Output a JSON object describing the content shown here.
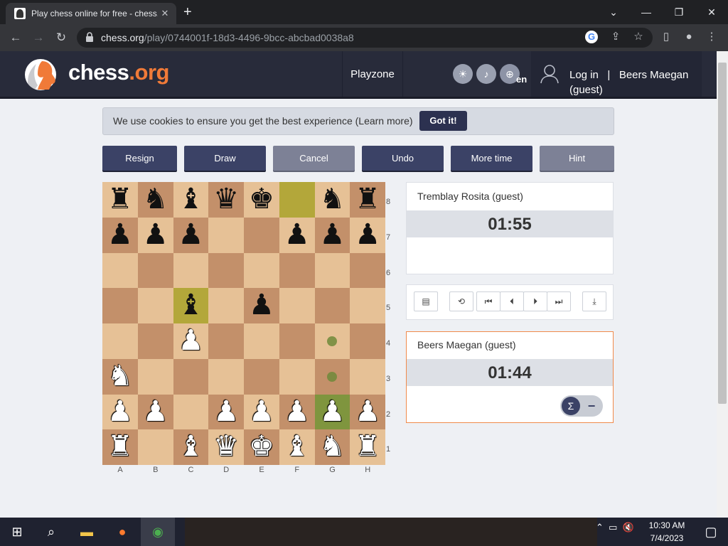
{
  "browser": {
    "tab_title": "Play chess online for free - chess.org",
    "tab_close": "✕",
    "new_tab": "+",
    "url_host": "chess.org",
    "url_path": "/play/0744001f-18d3-4496-9bcc-abcbad0038a8"
  },
  "header": {
    "logo_main": "chess",
    "logo_tld": ".org",
    "nav_playzone": "Playzone",
    "lang": "en",
    "login": "Log in",
    "separator": "|",
    "username": "Beers Maegan",
    "user_status": "(guest)"
  },
  "cookie": {
    "text": "We use cookies to ensure you get the best experience (Learn more)",
    "button": "Got it!"
  },
  "actions": {
    "resign": "Resign",
    "draw": "Draw",
    "cancel": "Cancel",
    "undo": "Undo",
    "more_time": "More time",
    "hint": "Hint"
  },
  "board": {
    "files": [
      "A",
      "B",
      "C",
      "D",
      "E",
      "F",
      "G",
      "H"
    ],
    "ranks": [
      "8",
      "7",
      "6",
      "5",
      "4",
      "3",
      "2",
      "1"
    ],
    "pieces": [
      "rnbqk.nr",
      "ppp..ppp",
      "........",
      "..b.p...",
      "..P.....",
      "N.......",
      "PP.PPPPP",
      "R.BQKBNR"
    ],
    "highlights": [
      "f8",
      "c5"
    ],
    "selected": [
      "g2"
    ],
    "move_hints": [
      "g4",
      "g3"
    ]
  },
  "players": {
    "top": {
      "name": "Tremblay Rosita (guest)",
      "clock": "01:55"
    },
    "bottom": {
      "name": "Beers Maegan (guest)",
      "clock": "01:44"
    }
  },
  "controls": {
    "sigma": "Σ",
    "minus": "−"
  },
  "taskbar": {
    "time": "10:30 AM",
    "date": "7/4/2023"
  },
  "colors": {
    "header_bg": "#282b3a",
    "accent_orange": "#f07a38",
    "button_dark": "#3b4266",
    "board_light": "#e6c196",
    "board_dark": "#c3906a"
  }
}
